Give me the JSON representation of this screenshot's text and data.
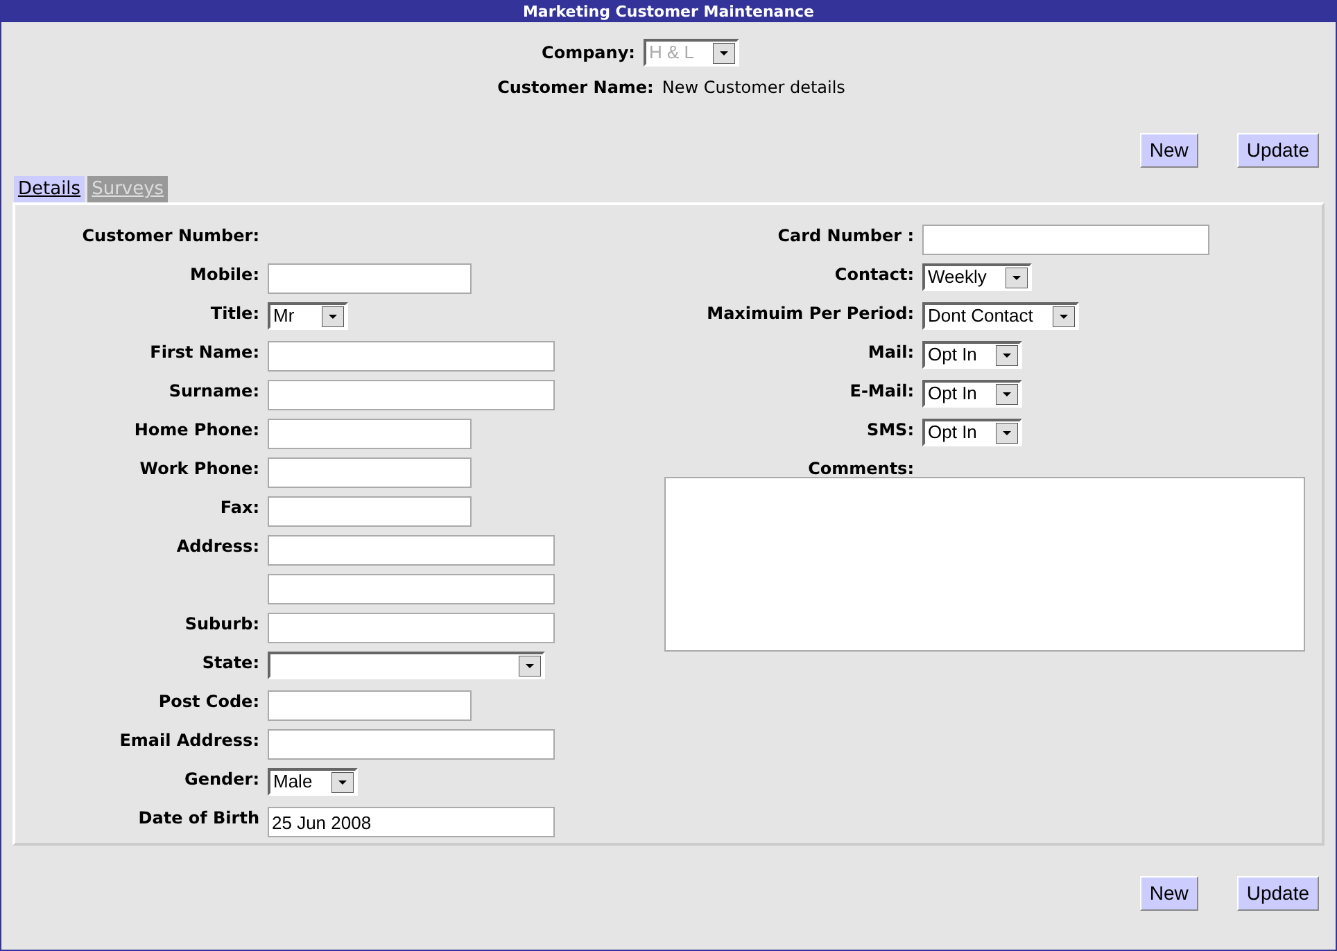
{
  "window": {
    "title": "Marketing Customer Maintenance"
  },
  "header": {
    "company": {
      "label": "Company:",
      "value": "H & L",
      "disabled": true
    },
    "customer_name": {
      "label": "Customer Name:",
      "value": "New Customer details"
    }
  },
  "top_buttons": [
    "New",
    "Update"
  ],
  "tabs": [
    {
      "label": "Details",
      "selected": true
    },
    {
      "label": "Surveys",
      "selected": false
    }
  ],
  "left_fields": [
    {
      "label": "Customer Number:",
      "kind": "label"
    },
    {
      "label": "Mobile:",
      "kind": "short"
    },
    {
      "label": "Title:",
      "kind": "select",
      "value": "Mr"
    },
    {
      "label": "First Name:",
      "kind": "long"
    },
    {
      "label": "Surname:",
      "kind": "long"
    },
    {
      "label": "Home Phone:",
      "kind": "short"
    },
    {
      "label": "Work Phone:",
      "kind": "short"
    },
    {
      "label": "Fax:",
      "kind": "short"
    },
    {
      "label": "Address:",
      "kind": "long"
    },
    {
      "kind": "long"
    },
    {
      "label": "Suburb:",
      "kind": "long"
    },
    {
      "label": "State:",
      "kind": "wide_select"
    },
    {
      "label": "Post Code:",
      "kind": "short"
    },
    {
      "label": "Email Address:",
      "kind": "long"
    },
    {
      "label": "Gender:",
      "kind": "select",
      "value": "Male"
    },
    {
      "label": "Date of Birth",
      "kind": "long",
      "value": "25 Jun 2008"
    }
  ],
  "right_fields": [
    {
      "label": "Card Number :",
      "kind": "long"
    },
    {
      "label": "Contact:",
      "kind": "select",
      "value": "Weekly"
    },
    {
      "label": "Maximuim Per Period:",
      "kind": "select",
      "value": "Dont Contact"
    },
    {
      "label": "Mail:",
      "kind": "select",
      "value": "Opt In"
    },
    {
      "label": "E-Mail:",
      "kind": "select",
      "value": "Opt In"
    },
    {
      "label": "SMS:",
      "kind": "select",
      "value": "Opt In"
    },
    {
      "label": "Comments:",
      "kind": "label"
    }
  ],
  "bottom_buttons": [
    "New",
    "Update"
  ]
}
